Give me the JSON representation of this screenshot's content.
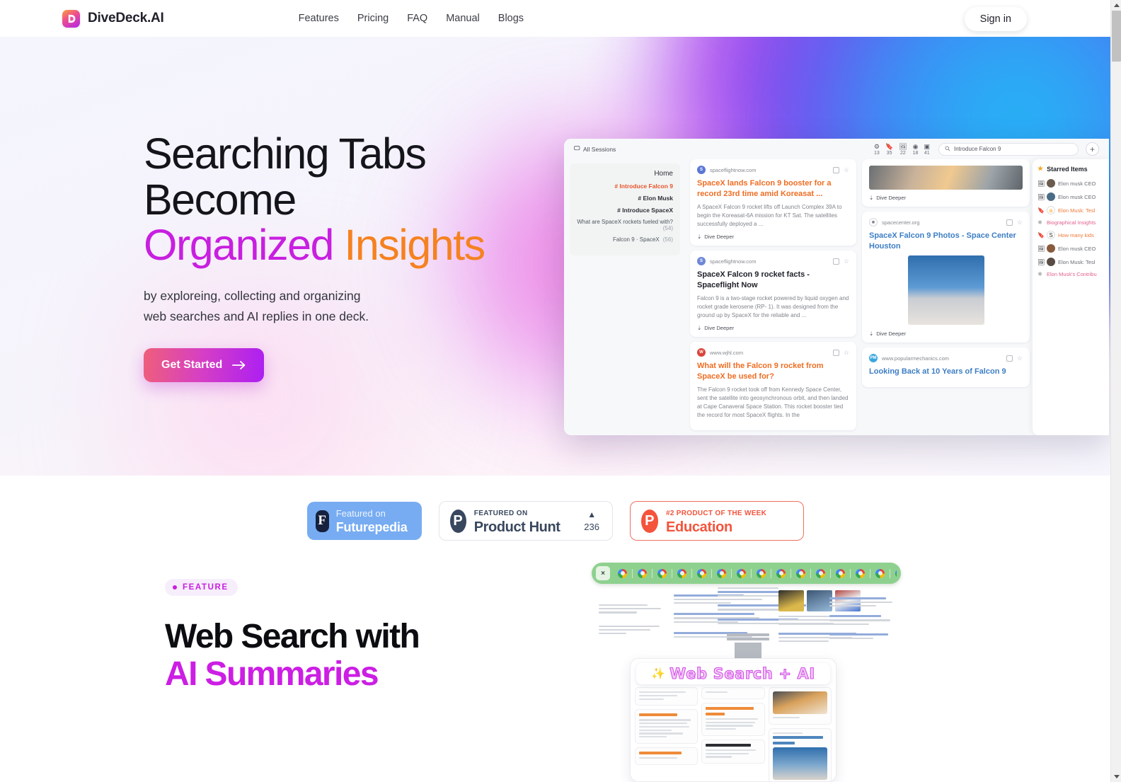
{
  "header": {
    "brand": "DiveDeck.AI",
    "logo_icon": "divedeck-logo-icon",
    "nav": [
      {
        "label": "Features"
      },
      {
        "label": "Pricing"
      },
      {
        "label": "FAQ"
      },
      {
        "label": "Manual"
      },
      {
        "label": "Blogs"
      }
    ],
    "signin_label": "Sign in"
  },
  "hero": {
    "title_line1": "Searching Tabs",
    "title_line2": "Become",
    "title_word_organized": "Organized",
    "title_word_insights": "Insights",
    "subtitle_line1": "by exploreing, collecting and organizing",
    "subtitle_line2": "web searches and AI replies in one deck.",
    "cta_label": "Get Started",
    "colors": {
      "organized": "#c81fe0",
      "insights": "#f58220",
      "cta_gradient_from": "#ef5f7a",
      "cta_gradient_to": "#ac1ff2"
    }
  },
  "mockup": {
    "sessions_label": "All Sessions",
    "counters": [
      {
        "icon": "gear-icon",
        "value": "13"
      },
      {
        "icon": "bookmark-icon",
        "value": "35"
      },
      {
        "icon": "image-icon",
        "value": "22"
      },
      {
        "icon": "globe-icon",
        "value": "18"
      },
      {
        "icon": "card-icon",
        "value": "41"
      }
    ],
    "search_value": "Introduce Falcon 9",
    "add_label": "+",
    "outline": {
      "home": "Home",
      "headings": [
        {
          "text": "# Introduce Falcon 9",
          "active": true
        },
        {
          "text": "# Elon Musk",
          "active": false
        },
        {
          "text": "# Introduce SpaceX",
          "active": false
        }
      ],
      "questions": [
        {
          "text": "What are SpaceX rockets fueled with?",
          "count": "(54)"
        },
        {
          "text": "Falcon 9 · SpaceX",
          "count": "(56)"
        }
      ]
    },
    "cards_mid": [
      {
        "domain": "spaceflightnow.com",
        "title": "SpaceX lands Falcon 9 booster for a record 23rd time amid Koreasat ...",
        "body": "A SpaceX Falcon 9 rocket lifts off Launch Complex 39A to begin the Koreasat-6A mission for KT Sat. The satellites successfully deployed a ...",
        "dive": "Dive Deeper",
        "title_color": "orange"
      },
      {
        "domain": "spaceflightnow.com",
        "title": "SpaceX Falcon 9 rocket facts - Spaceflight Now",
        "body": "Falcon 9 is a two-stage rocket powered by liquid oxygen and rocket grade kerosene (RP- 1). It was designed from the ground up by SpaceX for the reliable and ...",
        "dive": "Dive Deeper",
        "title_color": "dark"
      },
      {
        "domain": "www.wjhl.com",
        "title": "What will the Falcon 9 rocket from SpaceX be used for?",
        "body": "The Falcon 9 rocket took off from Kennedy Space Center, sent the satellite into geosynchronous orbit, and then landed at Cape Canaveral Space Station. This rocket booster tied the record for most SpaceX flights. In the",
        "dive": "Dive Deeper",
        "title_color": "orange"
      }
    ],
    "cards_right": [
      {
        "domain": "",
        "title": "",
        "dive": "Dive Deeper",
        "title_color": "dark"
      },
      {
        "domain": "spacecenter.org",
        "title": "SpaceX Falcon 9 Photos - Space Center Houston",
        "dive": "Dive Deeper",
        "title_color": "blue"
      },
      {
        "domain": "www.popularmechanics.com",
        "title": "Looking Back at 10 Years of Falcon 9",
        "dive": "",
        "title_color": "blue"
      }
    ],
    "starred": {
      "title": "Starred Items",
      "items": [
        {
          "type": "image-icon",
          "text": "Elon musk CEO",
          "tone": "grey"
        },
        {
          "type": "image-icon",
          "text": "Elon musk CEO",
          "tone": "grey"
        },
        {
          "type": "bookmark-icon",
          "text": "Elon Musk: Tesl",
          "tone": "orange"
        },
        {
          "type": "atom-icon",
          "text": "Biographical Insights",
          "tone": "pink"
        },
        {
          "type": "bookmark-icon",
          "text": "How many kids",
          "tone": "orange"
        },
        {
          "type": "image-icon",
          "text": "Elon musk CEO",
          "tone": "grey"
        },
        {
          "type": "image-icon",
          "text": "Elon Musk: Tesl",
          "tone": "grey"
        },
        {
          "type": "atom-icon",
          "text": "Elon Musk's Contribu",
          "tone": "pink"
        }
      ]
    }
  },
  "badges": {
    "futurepedia": {
      "line1": "Featured on",
      "line2": "Futurepedia",
      "mark": "F",
      "bg": "#77acf2"
    },
    "producthunt": {
      "line1": "FEATURED ON",
      "line2": "Product Hunt",
      "mark": "P",
      "vote_arrow": "▲",
      "vote_count": "236"
    },
    "education": {
      "line1": "#2 PRODUCT OF THE WEEK",
      "line2": "Education",
      "mark": "P",
      "accent": "#f4543c"
    }
  },
  "feature": {
    "pill_label": "FEATURE",
    "title_line1": "Web Search with",
    "title_line2": "AI Summaries",
    "accent": "#cc1ee4",
    "illustration": {
      "close_label": "×",
      "tab_icon": "chrome-tab-icon",
      "tab_count": 17,
      "banner_sparkle": "✨",
      "banner_text": "Web Search + AI",
      "arrow_icon": "down-arrow-icon"
    }
  }
}
